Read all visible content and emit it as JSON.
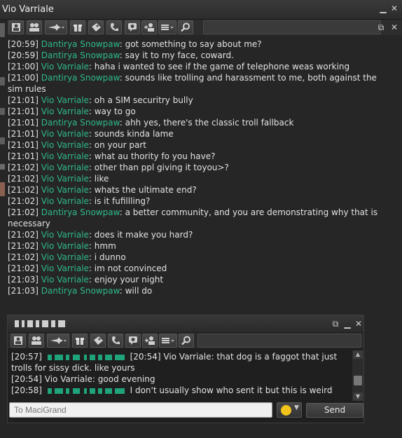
{
  "window": {
    "title": "Vio Varriale"
  },
  "chat": {
    "lines": [
      {
        "ts": "[20:59]",
        "name": "Dantirya Snowpaw",
        "msg": ": got something to say about me?"
      },
      {
        "ts": "[20:59]",
        "name": "Dantirya Snowpaw",
        "msg": ": say it to my face, coward."
      },
      {
        "ts": "[21:00]",
        "name": "Vio Varriale",
        "msg": ": haha i wanted to see if the game of telephone weas working"
      },
      {
        "ts": "[21:00]",
        "name": "Dantirya Snowpaw",
        "msg": ": sounds like trolling and harassment to me, both against the sim rules"
      },
      {
        "ts": "[21:01]",
        "name": "Vio Varriale",
        "msg": ": oh a SIM securitry bully"
      },
      {
        "ts": "[21:01]",
        "name": "Vio Varriale",
        "msg": ": way to go"
      },
      {
        "ts": "[21:01]",
        "name": "Dantirya Snowpaw",
        "msg": ": ahh yes, there's the classic troll fallback"
      },
      {
        "ts": "[21:01]",
        "name": "Vio Varriale",
        "msg": ": sounds kinda lame"
      },
      {
        "ts": "[21:01]",
        "name": "Vio Varriale",
        "msg": ": on your part"
      },
      {
        "ts": "[21:01]",
        "name": "Vio Varriale",
        "msg": ": what au thority fo you have?"
      },
      {
        "ts": "[21:02]",
        "name": "Vio Varriale",
        "msg": ": other than ppl giving it toyou>?"
      },
      {
        "ts": "[21:02]",
        "name": "Vio Varriale",
        "msg": ": like"
      },
      {
        "ts": "[21:02]",
        "name": "Vio Varriale",
        "msg": ": whats the ultimate end?"
      },
      {
        "ts": "[21:02]",
        "name": "Vio Varriale",
        "msg": ": is it fufillling?"
      },
      {
        "ts": "[21:02]",
        "name": "Dantirya Snowpaw",
        "msg": ": a better community, and you are demonstrating why that is necessary"
      },
      {
        "ts": "[21:02]",
        "name": "Vio Varriale",
        "msg": ": does it make you hard?"
      },
      {
        "ts": "[21:02]",
        "name": "Vio Varriale",
        "msg": ": hmm"
      },
      {
        "ts": "[21:02]",
        "name": "Vio Varriale",
        "msg": ": i dunno"
      },
      {
        "ts": "[21:02]",
        "name": "Vio Varriale",
        "msg": ": im not convinced"
      },
      {
        "ts": "[21:03]",
        "name": "Vio Varriale",
        "msg": ": enjoy your night"
      },
      {
        "ts": "[21:03]",
        "name": "Dantirya Snowpaw",
        "msg": ": will do"
      }
    ]
  },
  "im": {
    "lines": [
      {
        "ts": "[20:57]",
        "rest": "[20:54] Vio Varriale: that dog is a faggot that just trolls for sissy dick. like yours",
        "redacted_sender": true
      },
      {
        "ts": "[20:54]",
        "rest": "Vio Varriale: good evening",
        "redacted_sender": false
      },
      {
        "ts": "[20:58]",
        "rest": "I don't usually show who sent it but this is weird",
        "redacted_sender": true
      }
    ],
    "input_placeholder": "To MaciGrand",
    "send_label": "Send"
  },
  "icons": [
    "profile-icon",
    "friends-icon",
    "teleport-icon",
    "pay-icon",
    "call-icon",
    "history-icon",
    "add-group-icon",
    "more-icon",
    "search-icon",
    "smiley-icon"
  ],
  "colors": {
    "name_green": "#2fb98c",
    "smiley": "#f2c31b"
  }
}
